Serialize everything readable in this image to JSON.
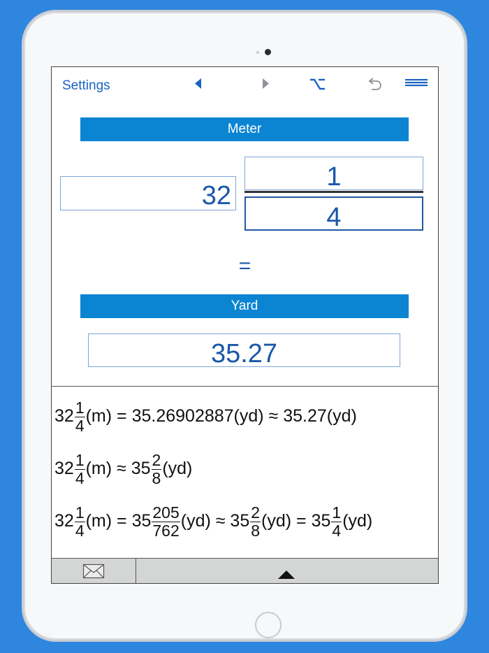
{
  "toolbar": {
    "settings_label": "Settings",
    "icons": [
      "back-arrow-icon",
      "forward-arrow-icon",
      "option-key-icon",
      "undo-icon",
      "menu-icon"
    ]
  },
  "converter": {
    "from_unit": "Meter",
    "whole_value": "32",
    "numerator": "1",
    "denominator": "4",
    "equals": "=",
    "to_unit": "Yard",
    "result": "35.27"
  },
  "results": {
    "line1": {
      "whole": "32",
      "num": "1",
      "den": "4",
      "rest": "(m) = 35.26902887(yd) ≈ 35.27(yd)"
    },
    "line2": {
      "whole": "32",
      "num": "1",
      "den": "4",
      "mid": "(m) ≈ 35",
      "num2": "2",
      "den2": "8",
      "tail": "(yd)"
    },
    "line3": {
      "whole": "32",
      "num": "1",
      "den": "4",
      "mid1": "(m) = 35",
      "num2": "205",
      "den2": "762",
      "mid2": "(yd) ≈ 35",
      "num3": "2",
      "den3": "8",
      "mid3": "(yd) = 35",
      "num4": "1",
      "den4": "4",
      "tail": "(yd)"
    }
  },
  "bottom_bar": {
    "icons": [
      "mail-icon",
      "expand-up-icon"
    ]
  },
  "colors": {
    "background": "#2f86df",
    "accent_bar": "#0b84d2",
    "value_text": "#1a57a8",
    "link": "#1a62c4"
  }
}
